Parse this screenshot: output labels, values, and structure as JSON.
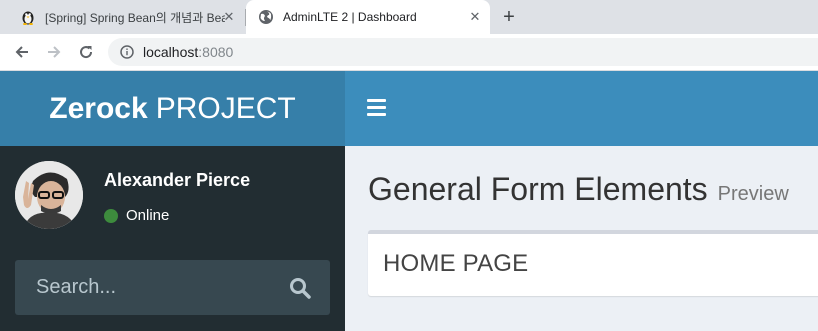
{
  "browser": {
    "tabs": [
      {
        "title": "[Spring] Spring Bean의 개념과 Bean",
        "active": false,
        "icon": "penguin-icon"
      },
      {
        "title": "AdminLTE 2 | Dashboard",
        "active": true,
        "icon": "globe-icon"
      }
    ],
    "close_glyph": "✕",
    "new_tab_glyph": "+",
    "url_host": "localhost",
    "url_port": ":8080"
  },
  "app": {
    "logo_bold": "Zerock",
    "logo_rest": "PROJECT",
    "colors": {
      "header": "#3c8dbc",
      "logo": "#367fa9",
      "sidebar": "#222d32",
      "content": "#ecf0f5"
    }
  },
  "sidebar": {
    "user_name": "Alexander Pierce",
    "status": "Online",
    "search_placeholder": "Search..."
  },
  "content": {
    "title": "General Form Elements",
    "subtitle": "Preview",
    "box_title": "HOME PAGE"
  }
}
